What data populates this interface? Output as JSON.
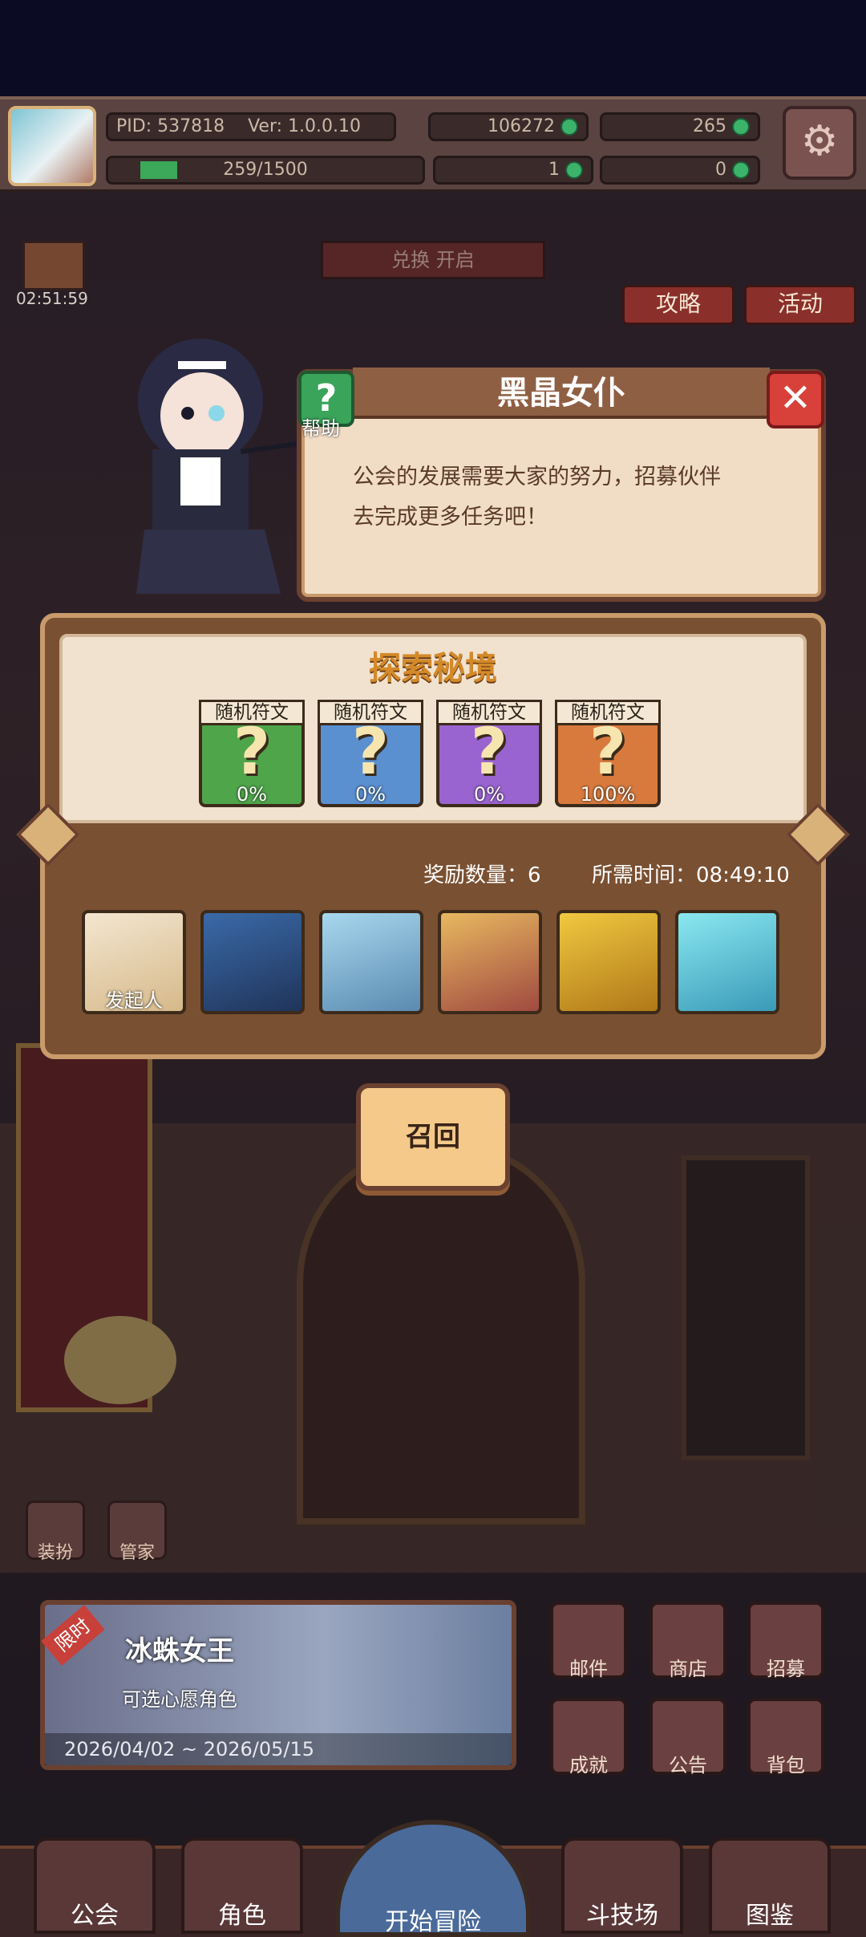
{
  "header": {
    "pid": "PID: 537818",
    "version": "Ver: 1.0.0.10",
    "currency1": "106272",
    "currency2": "265",
    "exp": "259/1500",
    "count1": "1",
    "count2": "0"
  },
  "overlay": {
    "timer": "02:51:59",
    "exchange_banner": "兑换 开启",
    "strategy": "攻略",
    "activity": "活动"
  },
  "dialog": {
    "speaker": "黑晶女仆",
    "help_label": "帮助",
    "text_line1": "公会的发展需要大家的努力，招募伙伴",
    "text_line2": "去完成更多任务吧！"
  },
  "expedition": {
    "title": "探索秘境",
    "cards": [
      {
        "label": "随机符文",
        "mark": "?",
        "percent": "0%",
        "color": "#4fa54a"
      },
      {
        "label": "随机符文",
        "mark": "?",
        "percent": "0%",
        "color": "#5a90d0"
      },
      {
        "label": "随机符文",
        "mark": "?",
        "percent": "0%",
        "color": "#9a64d0"
      },
      {
        "label": "随机符文",
        "mark": "?",
        "percent": "100%",
        "color": "#d87a3e"
      }
    ],
    "reward_label": "奖励数量：6",
    "time_label": "所需时间：08:49:10",
    "initiator": "发起人",
    "recall": "召回"
  },
  "tools": {
    "dress": "装扮",
    "butler": "管家"
  },
  "banner": {
    "tag": "限时",
    "title": "冰蛛女王",
    "subtitle": "可选心愿角色",
    "dates": "2026/04/02 ~ 2026/05/15"
  },
  "menu": {
    "mail": "邮件",
    "shop": "商店",
    "recruit": "招募",
    "achievement": "成就",
    "notice": "公告",
    "bag": "背包"
  },
  "nav": {
    "guild": "公会",
    "role": "角色",
    "adventure": "开始冒险",
    "arena": "斗技场",
    "codex": "图鉴"
  }
}
